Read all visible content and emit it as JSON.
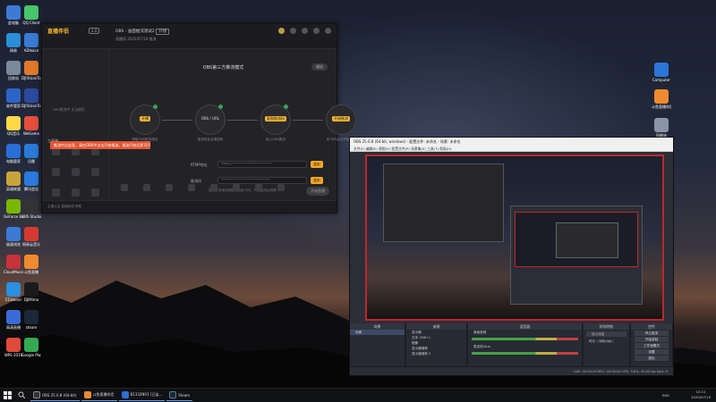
{
  "desktop": {
    "icons": [
      {
        "label": "此电脑",
        "color": "#3b7bd6"
      },
      {
        "label": "QQ Client",
        "color": "#49c46a"
      },
      {
        "label": "网易",
        "color": "#2a8fd8"
      },
      {
        "label": "ADVoice",
        "color": "#3a7ad4"
      },
      {
        "label": "回收站",
        "color": "#7a8899"
      },
      {
        "label": "DJIVisionTools",
        "color": "#e07a2a"
      },
      {
        "label": "软件管家",
        "color": "#2b64c8"
      },
      {
        "label": "DJIVisionTools",
        "color": "#2a4aa0"
      },
      {
        "label": "QQ音乐",
        "color": "#ffd84a"
      },
      {
        "label": "WeGame",
        "color": "#e64e3c"
      },
      {
        "label": "电脑管家",
        "color": "#2a6ed8"
      },
      {
        "label": "迅雷",
        "color": "#2a7ad8"
      },
      {
        "label": "英雄联盟",
        "color": "#c8a43a"
      },
      {
        "label": "腾讯会议",
        "color": "#2a7ae0"
      },
      {
        "label": "GeForce Experience",
        "color": "#76b900"
      },
      {
        "label": "OBS Studio",
        "color": "#333333"
      },
      {
        "label": "极速浏览",
        "color": "#3b7bd6"
      },
      {
        "label": "网易云音乐",
        "color": "#d53a32"
      },
      {
        "label": "CloudMusic",
        "color": "#c8323a"
      },
      {
        "label": "斗鱼直播",
        "color": "#f08a30"
      },
      {
        "label": "CCleaner",
        "color": "#2a8fe0"
      },
      {
        "label": "DJIMimo",
        "color": "#1a1a1a"
      },
      {
        "label": "高清直播",
        "color": "#3a6ad8"
      },
      {
        "label": "steam",
        "color": "#1b2838"
      },
      {
        "label": "WPS 2019",
        "color": "#e04a3a"
      },
      {
        "label": "Google Play",
        "color": "#34a853"
      },
      {
        "label": "Computer",
        "color": "#2b76d8"
      },
      {
        "label": "斗鱼直播伴侣",
        "color": "#f08a30"
      },
      {
        "label": "回收站",
        "color": "#8a96a6"
      }
    ]
  },
  "live_app": {
    "logo": "直播伴侣",
    "version": "2.0",
    "room_title": "OBS - 画面推流测试2",
    "room_badge": "开播",
    "room_meta": "直播间   2020/07/19   推流",
    "obs_mode_title": "OBS第三方推流模式",
    "obs_mode_btn": "退出",
    "sidebar_text": "OBS推流中  无法使用",
    "sidebar_section": "工具箱",
    "steps": [
      {
        "label": "开播",
        "caption": "获取OBS推流地址"
      },
      {
        "label": "OBS / URL",
        "caption": "推流地址及推流码"
      },
      {
        "label": "复制推流码",
        "caption": "填入OBS推流"
      },
      {
        "label": "开始推流",
        "caption": "在OBS点击开始推流"
      }
    ],
    "rtmp_label": "RTMP地址",
    "rtmp_value": "rtmp://•••••••••••••••••••••",
    "key_label": "推流码",
    "key_value": "••••••••••••••••••••••••••",
    "copy_label": "复制",
    "hint": "复制推流地址和推流码至OBS，开始推流后观看",
    "tooltip": "推流中点这里，请在OBS中点击开始推流，推流开始后即可开播",
    "start_btn": "开始直播",
    "footer": "主播认证  直播权限  帮助"
  },
  "obs": {
    "title": "OBS 25.0.8 (64-bit, windows) - 配置文件: 未命名 - 场景: 未命名",
    "menu": "文件(F)  编辑(E)  视图(V)  配置文件(P)  场景集(S)  工具(T)  帮助(H)",
    "docks": {
      "scenes_title": "场景",
      "scenes": [
        "场景"
      ],
      "sources_title": "来源",
      "sources": [
        "显示器",
        "文本 (GDI+)",
        "图像",
        "显示器捕获",
        "显示器捕获 2",
        "媒体源"
      ],
      "mixer_title": "混音器",
      "mixer": [
        "桌面音频",
        "麦克风/Aux"
      ],
      "transitions_title": "转场特效",
      "transition": "淡入淡出",
      "duration_label": "时长",
      "duration": "300 ms",
      "controls_title": "控件",
      "controls": [
        "停止推流",
        "开始录制",
        "工作室模式",
        "设置",
        "退出"
      ]
    },
    "status": "LIVE: 00:00:00   REC: 00:00:00   CPU: 3.6%, 30.00 fps   kb/s: 0"
  },
  "taskbar": {
    "items": [
      {
        "label": "OBS 25.0.8 (64-bit)",
        "color": "#333"
      },
      {
        "label": "斗鱼直播伴侣",
        "color": "#f08a30"
      },
      {
        "label": "B1332N01 [已连...",
        "color": "#2a6ed8"
      },
      {
        "label": "Steam",
        "color": "#1b2838"
      }
    ],
    "time": "10:11",
    "date": "2020/07/19",
    "lang": "ENG"
  }
}
